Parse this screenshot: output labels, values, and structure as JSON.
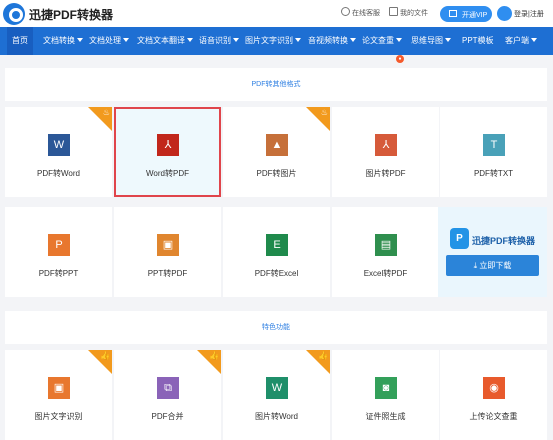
{
  "topbar": {
    "brand": "迅捷PDF转换器",
    "online_help": "在线客服",
    "my_files": "我的文件",
    "vip": "开通VIP",
    "login": "登录|注册"
  },
  "nav": {
    "items": [
      {
        "label": "首页",
        "active": true
      },
      {
        "label": "文档转换",
        "dropdown": true
      },
      {
        "label": "文档处理",
        "dropdown": true
      },
      {
        "label": "文档文本翻译",
        "dropdown": true
      },
      {
        "label": "语音识别",
        "dropdown": true
      },
      {
        "label": "图片文字识别",
        "dropdown": true
      },
      {
        "label": "音视频转换",
        "dropdown": true
      },
      {
        "label": "论文查重",
        "dropdown": true,
        "badge": true
      },
      {
        "label": "思维导图",
        "dropdown": true
      },
      {
        "label": "PPT模板"
      },
      {
        "label": "客户端",
        "dropdown": true
      }
    ]
  },
  "sections": {
    "pdf_other": "PDF转其他格式",
    "featured": "特色功能"
  },
  "row1": [
    {
      "label": "PDF转Word",
      "icon": "word-icon",
      "icon_text": "W",
      "color": "#2b5797",
      "hot": true
    },
    {
      "label": "Word转PDF",
      "icon": "pdf-icon",
      "icon_text": "⅄",
      "color": "#c1271b",
      "selected": true
    },
    {
      "label": "PDF转图片",
      "icon": "image-icon",
      "icon_text": "▲",
      "color": "#c6703a",
      "hot": true
    },
    {
      "label": "图片转PDF",
      "icon": "pdf-icon",
      "icon_text": "⅄",
      "color": "#d65a3a"
    },
    {
      "label": "PDF转TXT",
      "icon": "txt-icon",
      "icon_text": "T",
      "color": "#49a1b8"
    }
  ],
  "row2": [
    {
      "label": "PDF转PPT",
      "icon": "ppt-icon",
      "icon_text": "P",
      "color": "#e8772e"
    },
    {
      "label": "PPT转PDF",
      "icon": "ppt-pdf-icon",
      "icon_text": "▣",
      "color": "#e0862f"
    },
    {
      "label": "PDF转Excel",
      "icon": "excel-icon",
      "icon_text": "E",
      "color": "#1f8a4c"
    },
    {
      "label": "Excel转PDF",
      "icon": "excel-pdf-icon",
      "icon_text": "▤",
      "color": "#2f8f4e"
    }
  ],
  "ad": {
    "title": "迅捷PDF转换器",
    "button": "立即下载"
  },
  "row3": [
    {
      "label": "图片文字识别",
      "icon": "ocr-icon",
      "icon_text": "▣",
      "color": "#e8772e",
      "hot": true
    },
    {
      "label": "PDF合并",
      "icon": "merge-icon",
      "icon_text": "⧉",
      "color": "#8a63b8",
      "hot": true
    },
    {
      "label": "图片转Word",
      "icon": "word-icon",
      "icon_text": "W",
      "color": "#1f8f6a",
      "hot": true
    },
    {
      "label": "证件照生成",
      "icon": "id-photo-icon",
      "icon_text": "◙",
      "color": "#33a05a"
    },
    {
      "label": "上传论文查重",
      "icon": "paper-check-icon",
      "icon_text": "◉",
      "color": "#e85a2c"
    }
  ]
}
